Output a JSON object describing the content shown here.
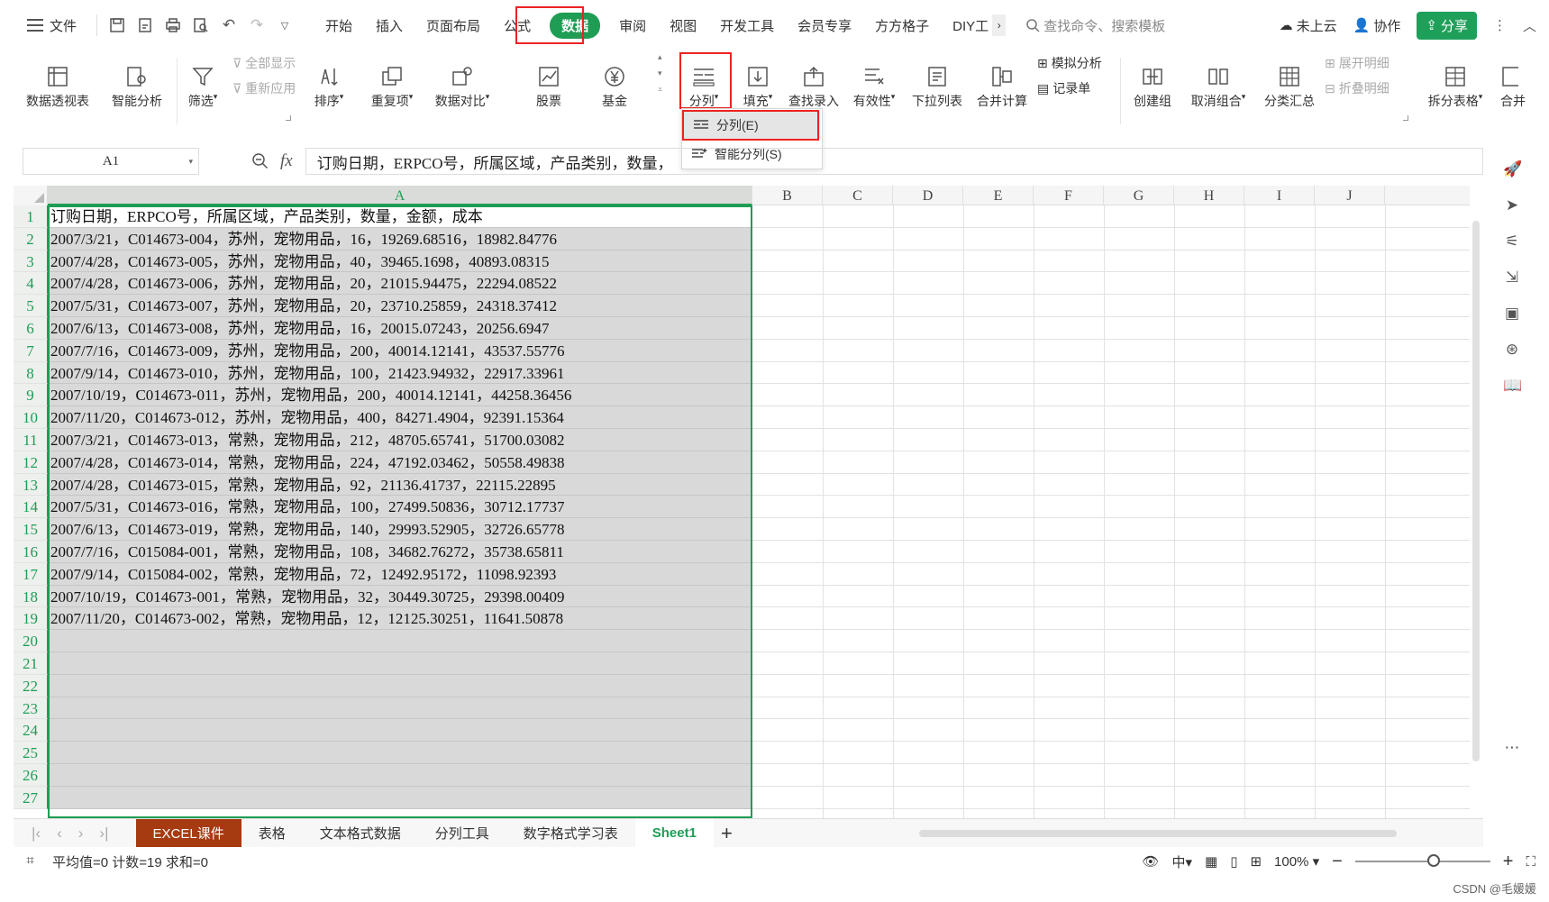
{
  "menubar": {
    "file": "文件",
    "tabs": [
      "开始",
      "插入",
      "页面布局",
      "公式",
      "数据",
      "审阅",
      "视图",
      "开发工具",
      "会员专享",
      "方方格子",
      "DIY工"
    ],
    "search_placeholder": "查找命令、搜索模板",
    "cloud": "未上云",
    "collab": "协作",
    "share": "分享"
  },
  "ribbon": {
    "pivot": "数据透视表",
    "smart_analysis": "智能分析",
    "filter": "筛选",
    "show_all": "全部显示",
    "reapply": "重新应用",
    "sort": "排序",
    "duplicates": "重复项",
    "compare": "数据对比",
    "stock": "股票",
    "fund": "基金",
    "split": "分列",
    "fill": "填充",
    "lookup": "查找录入",
    "validity": "有效性",
    "dropdown_list": "下拉列表",
    "consolidate": "合并计算",
    "whatif": "模拟分析",
    "record": "记录单",
    "group": "创建组",
    "ungroup": "取消组合",
    "subtotal": "分类汇总",
    "expand": "展开明细",
    "collapse": "折叠明细",
    "split_table": "拆分表格",
    "merge": "合并"
  },
  "dropdown": {
    "item1": "分列(E)",
    "item2": "智能分列(S)"
  },
  "formula": {
    "cell_ref": "A1",
    "fx": "fx",
    "content": "订购日期，ERPCO号，所属区域，产品类别，数量，"
  },
  "columns": [
    "A",
    "B",
    "C",
    "D",
    "E",
    "F",
    "G",
    "H",
    "I",
    "J"
  ],
  "rows": [
    "订购日期，ERPCO号，所属区域，产品类别，数量，金额，成本",
    "2007/3/21，C014673-004，苏州，宠物用品，16，19269.68516，18982.84776",
    "2007/4/28，C014673-005，苏州，宠物用品，40，39465.1698，40893.08315",
    "2007/4/28，C014673-006，苏州，宠物用品，20，21015.94475，22294.08522",
    "2007/5/31，C014673-007，苏州，宠物用品，20，23710.25859，24318.37412",
    "2007/6/13，C014673-008，苏州，宠物用品，16，20015.07243，20256.6947",
    "2007/7/16，C014673-009，苏州，宠物用品，200，40014.12141，43537.55776",
    "2007/9/14，C014673-010，苏州，宠物用品，100，21423.94932，22917.33961",
    "2007/10/19，C014673-011，苏州，宠物用品，200，40014.12141，44258.36456",
    "2007/11/20，C014673-012，苏州，宠物用品，400，84271.4904，92391.15364",
    "2007/3/21，C014673-013，常熟，宠物用品，212，48705.65741，51700.03082",
    "2007/4/28，C014673-014，常熟，宠物用品，224，47192.03462，50558.49838",
    "2007/4/28，C014673-015，常熟，宠物用品，92，21136.41737，22115.22895",
    "2007/5/31，C014673-016，常熟，宠物用品，100，27499.50836，30712.17737",
    "2007/6/13，C014673-019，常熟，宠物用品，140，29993.52905，32726.65778",
    "2007/7/16，C015084-001，常熟，宠物用品，108，34682.76272，35738.65811",
    "2007/9/14，C015084-002，常熟，宠物用品，72，12492.95172，11098.92393",
    "2007/10/19，C014673-001，常熟，宠物用品，32，30449.30725，29398.00409",
    "2007/11/20，C014673-002，常熟，宠物用品，12，12125.30251，11641.50878",
    "",
    "",
    "",
    "",
    "",
    "",
    "",
    ""
  ],
  "sheets": [
    "EXCEL课件",
    "表格",
    "文本格式数据",
    "分列工具",
    "数字格式学习表",
    "Sheet1"
  ],
  "status": {
    "summary": "平均值=0  计数=19  求和=0",
    "zoom": "100%"
  },
  "watermark": "CSDN @毛媛媛",
  "colors": {
    "accent": "#1f9d55",
    "highlight_box": "#e22222",
    "course_tab": "#a63a10"
  }
}
